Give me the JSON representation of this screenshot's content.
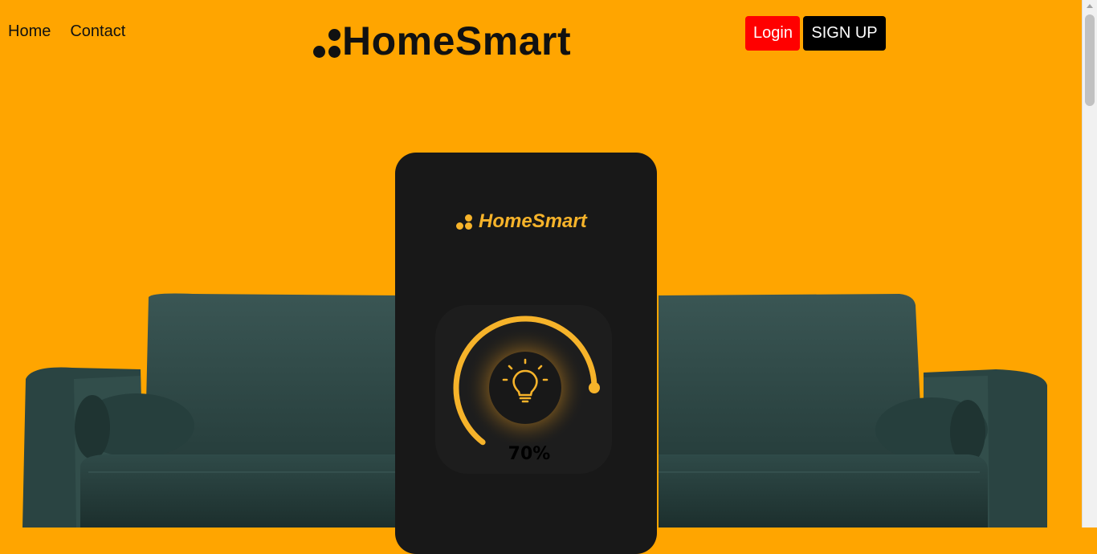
{
  "nav": {
    "home_label": "Home",
    "contact_label": "Contact"
  },
  "brand": {
    "title": "HomeSmart"
  },
  "auth": {
    "login_label": "Login",
    "signup_label": "SIGN UP"
  },
  "phone": {
    "brand_title": "HomeSmart",
    "light": {
      "level": 0.7,
      "percent_label": "70%",
      "icon": "lightbulb-icon"
    }
  },
  "colors": {
    "page_background": "#ffa500",
    "login_button": "#ff0000",
    "signup_button": "#000000",
    "accent": "#f6b32a",
    "phone_background": "#181818",
    "sofa": "#2f4b48"
  }
}
